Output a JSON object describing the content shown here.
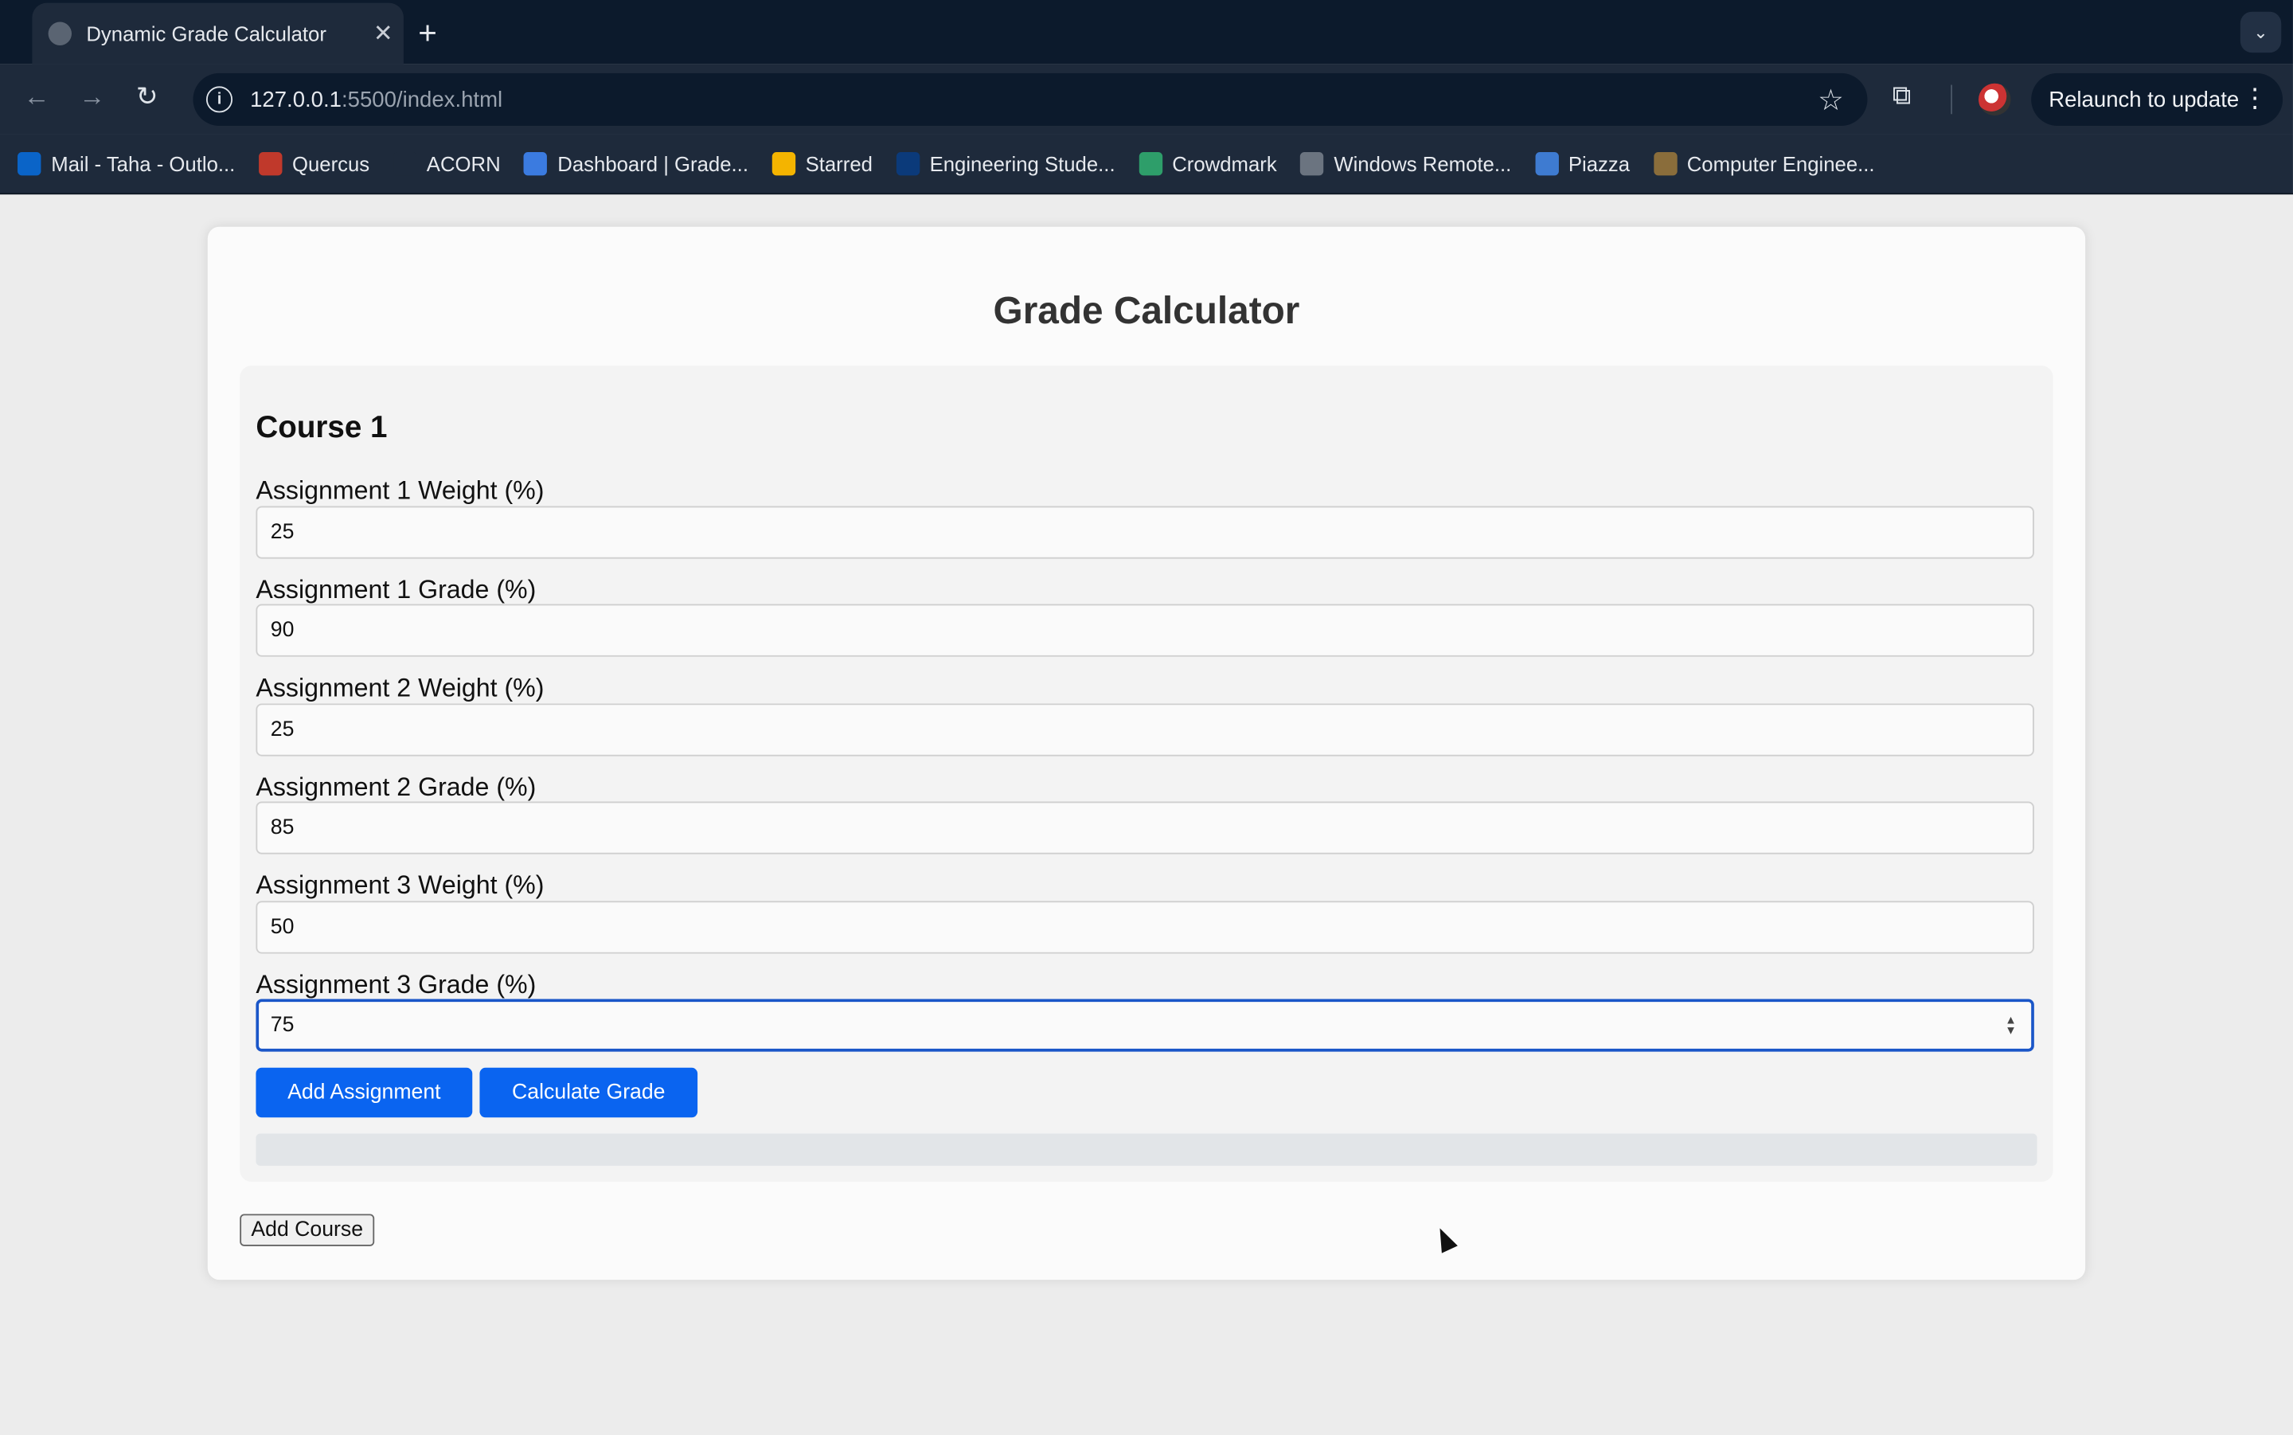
{
  "browser": {
    "tab_title": "Dynamic Grade Calculator",
    "new_tab_symbol": "+",
    "url_host": "127.0.0.1",
    "url_path": ":5500/index.html",
    "relaunch_label": "Relaunch to update"
  },
  "bookmarks": [
    {
      "label": "Mail - Taha - Outlo...",
      "icon": "outlook-icon",
      "color": "#0a64c8"
    },
    {
      "label": "Quercus",
      "icon": "quercus-icon",
      "color": "#c0392b"
    },
    {
      "label": "ACORN",
      "icon": "acorn-icon",
      "color": "#1e2a3b"
    },
    {
      "label": "Dashboard | Grade...",
      "icon": "bar-chart-icon",
      "color": "#3b7be0"
    },
    {
      "label": "Starred",
      "icon": "drive-icon",
      "color": "#f4b400"
    },
    {
      "label": "Engineering Stude...",
      "icon": "engineering-icon",
      "color": "#0b3a7a"
    },
    {
      "label": "Crowdmark",
      "icon": "crowdmark-icon",
      "color": "#2e9e6a"
    },
    {
      "label": "Windows Remote...",
      "icon": "ecf-icon",
      "color": "#6b7480"
    },
    {
      "label": "Piazza",
      "icon": "piazza-icon",
      "color": "#3e7bd1"
    },
    {
      "label": "Computer Enginee...",
      "icon": "computer-engineering-icon",
      "color": "#8a6d3b"
    }
  ],
  "page": {
    "title": "Grade Calculator",
    "course": {
      "title": "Course 1",
      "fields": [
        {
          "label": "Assignment 1 Weight (%)",
          "value": "25"
        },
        {
          "label": "Assignment 1 Grade (%)",
          "value": "90"
        },
        {
          "label": "Assignment 2 Weight (%)",
          "value": "25"
        },
        {
          "label": "Assignment 2 Grade (%)",
          "value": "85"
        },
        {
          "label": "Assignment 3 Weight (%)",
          "value": "50"
        },
        {
          "label": "Assignment 3 Grade (%)",
          "value": "75"
        }
      ],
      "add_assignment_label": "Add Assignment",
      "calculate_label": "Calculate Grade"
    },
    "add_course_label": "Add Course"
  },
  "colors": {
    "primary_button": "#0a64f0",
    "focus_border": "#1a56c8",
    "chrome_dark": "#0c1a2c",
    "chrome_mid": "#1e2a3b"
  }
}
